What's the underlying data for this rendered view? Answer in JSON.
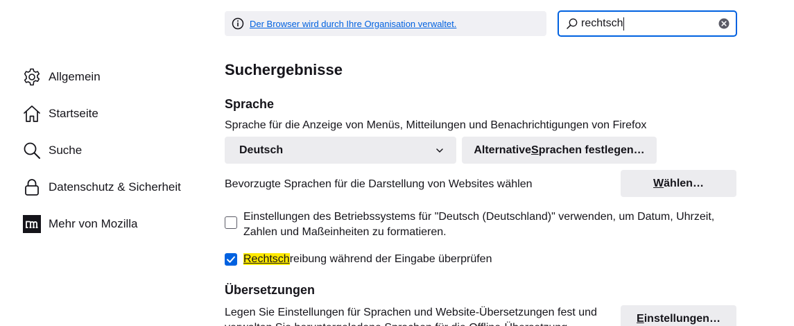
{
  "notice": {
    "text": "Der Browser wird durch Ihre Organisation verwaltet."
  },
  "search": {
    "query": "rechtsch"
  },
  "sidebar": {
    "items": [
      {
        "label": "Allgemein",
        "icon": "gear-icon"
      },
      {
        "label": "Startseite",
        "icon": "home-icon"
      },
      {
        "label": "Suche",
        "icon": "search-icon"
      },
      {
        "label": "Datenschutz & Sicherheit",
        "icon": "lock-icon"
      },
      {
        "label": "Mehr von Mozilla",
        "icon": "mozilla-icon"
      }
    ]
  },
  "main": {
    "title": "Suchergebnisse",
    "language": {
      "heading": "Sprache",
      "description": "Sprache für die Anzeige von Menüs, Mitteilungen und Benachrichtigungen von Firefox",
      "selected_language": "Deutsch",
      "alt_button": {
        "before": "Alternative ",
        "accesskey": "S",
        "after": "prachen festlegen…"
      },
      "preferred_text": "Bevorzugte Sprachen für die Darstellung von Websites wählen",
      "choose_button": {
        "before": "",
        "accesskey": "W",
        "after": "ählen…"
      },
      "os_settings_line1": "Einstellungen des Betriebssystems für \"Deutsch (Deutschland)\" verwenden, um Datum, Uhrzeit,",
      "os_settings_line2": "Zahlen und Maßeinheiten zu formatieren.",
      "os_settings_checked": false,
      "spellcheck": {
        "highlight": "Rechtsch",
        "rest": "reibung während der Eingabe überprüfen"
      },
      "spellcheck_checked": true
    },
    "translations": {
      "heading": "Übersetzungen",
      "description_line1": "Legen Sie Einstellungen für Sprachen und Website-Übersetzungen fest und",
      "description_line2": "verwalten Sie heruntergeladene Sprachen für die Offline-Übersetzung.",
      "settings_button": {
        "before": "",
        "accesskey": "E",
        "after": "instellungen…"
      }
    }
  },
  "colors": {
    "accent": "#0061e0",
    "highlight": "#ffe900",
    "button_bg": "#ececef",
    "notice_bg": "#f0f0f4"
  }
}
